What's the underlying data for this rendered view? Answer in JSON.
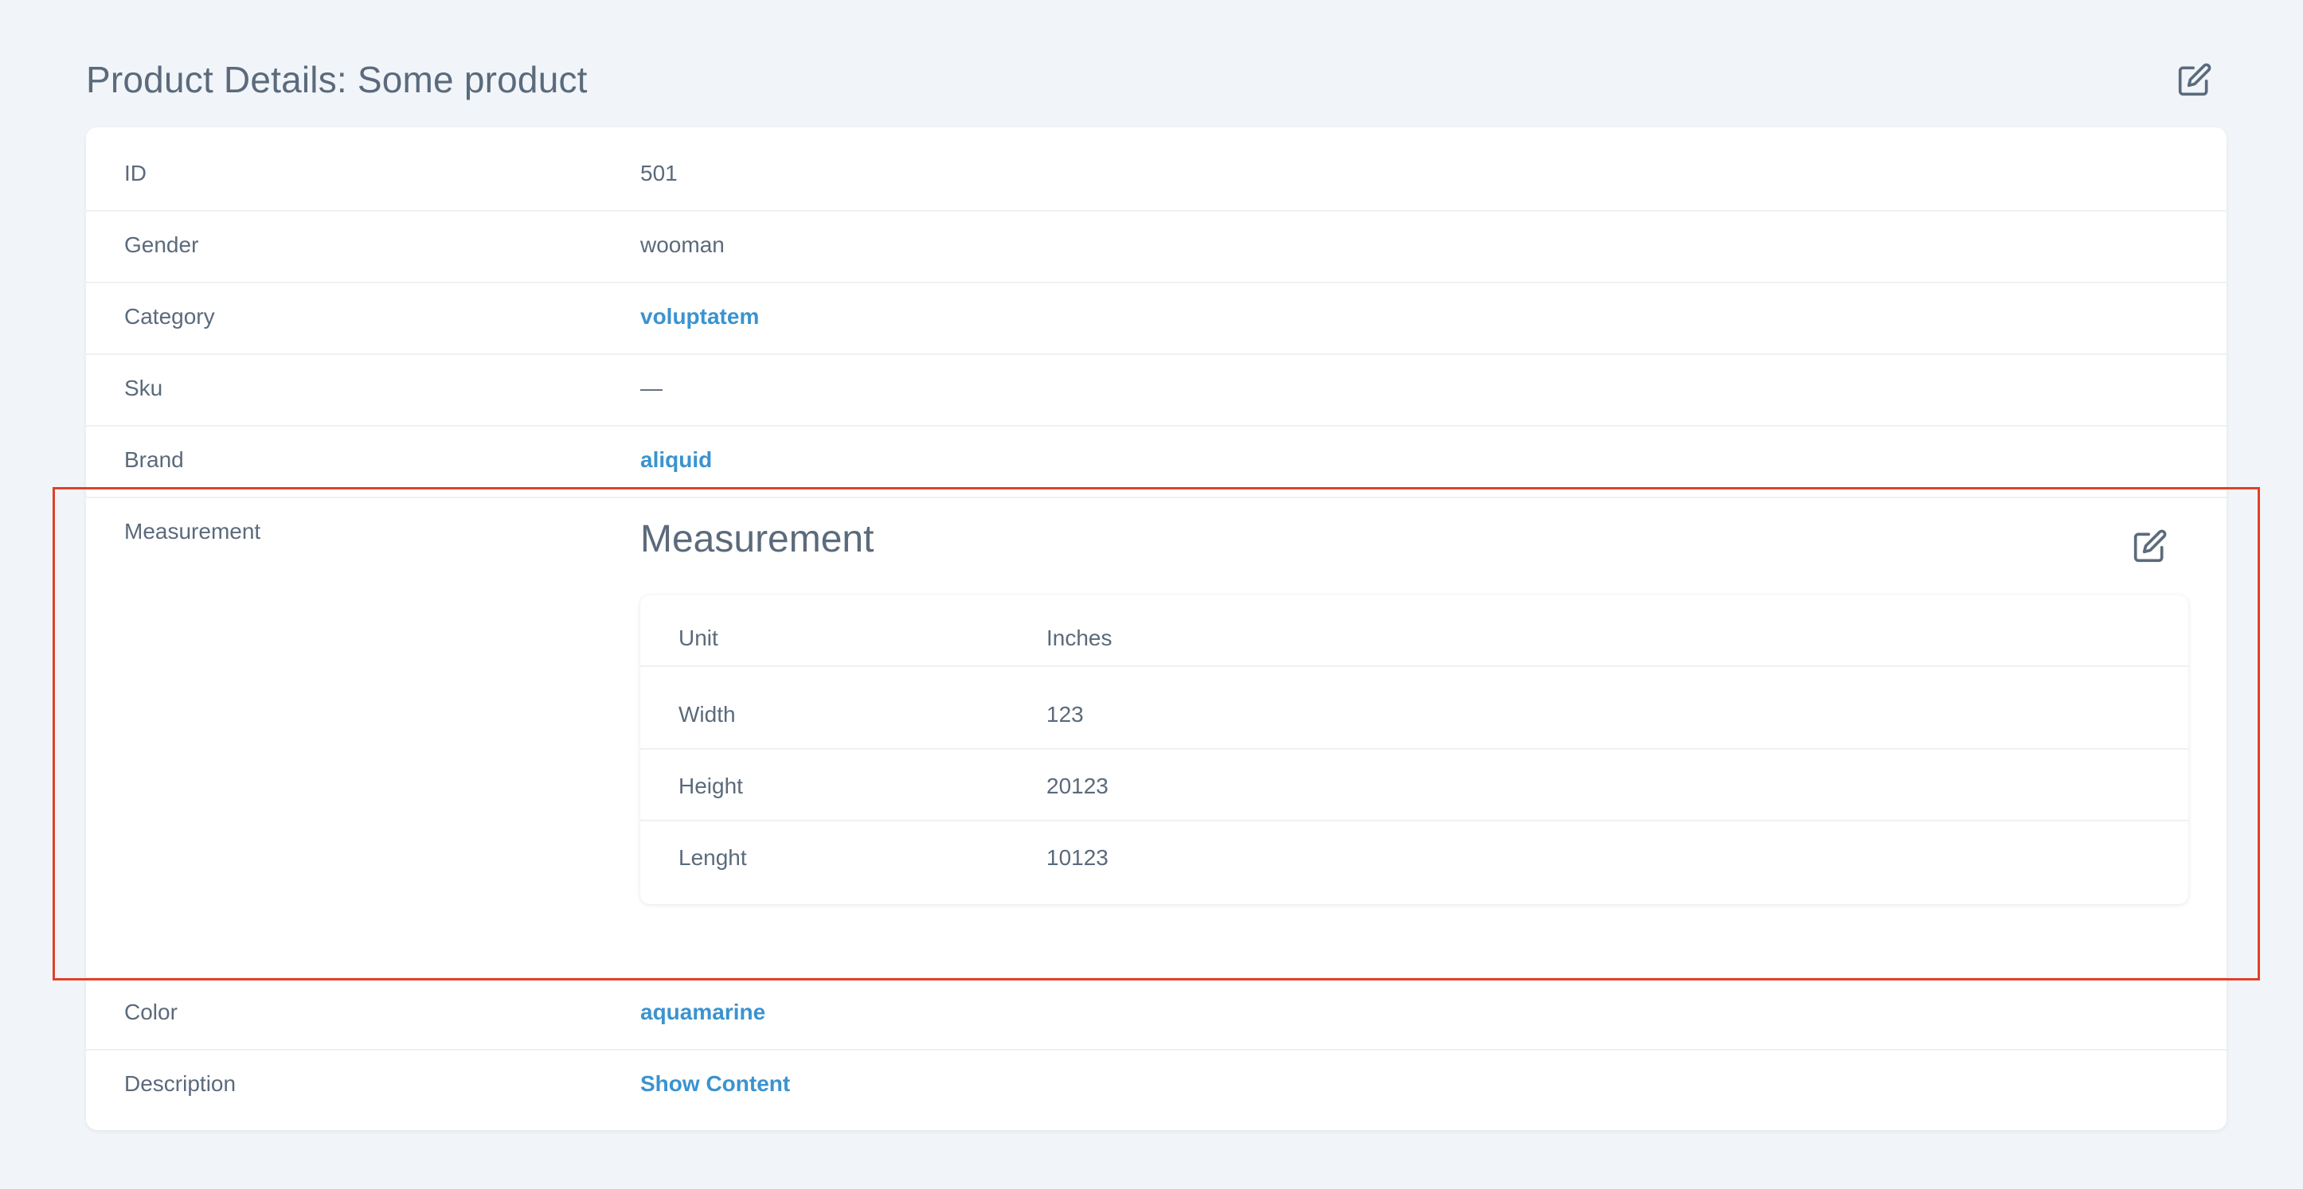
{
  "page": {
    "title": "Product Details: Some product"
  },
  "details": {
    "rows": [
      {
        "label": "ID",
        "value": "501"
      },
      {
        "label": "Gender",
        "value": "wooman"
      },
      {
        "label": "Category",
        "value": "voluptatem"
      },
      {
        "label": "Sku",
        "value": "—"
      },
      {
        "label": "Brand",
        "value": "aliquid"
      },
      {
        "label": "Measurement",
        "value": ""
      },
      {
        "label": "Color",
        "value": "aquamarine"
      },
      {
        "label": "Description",
        "value": "Show Content"
      }
    ]
  },
  "measurement": {
    "title": "Measurement",
    "rows": [
      {
        "label": "Unit",
        "value": "Inches"
      },
      {
        "label": "Width",
        "value": "123"
      },
      {
        "label": "Height",
        "value": "20123"
      },
      {
        "label": "Lenght",
        "value": "10123"
      }
    ]
  },
  "icons": {
    "edit": "edit-icon"
  },
  "colors": {
    "background": "#f1f5f9",
    "link": "#3a93cf",
    "text": "#5b6a7c",
    "highlight": "#e0412a"
  }
}
